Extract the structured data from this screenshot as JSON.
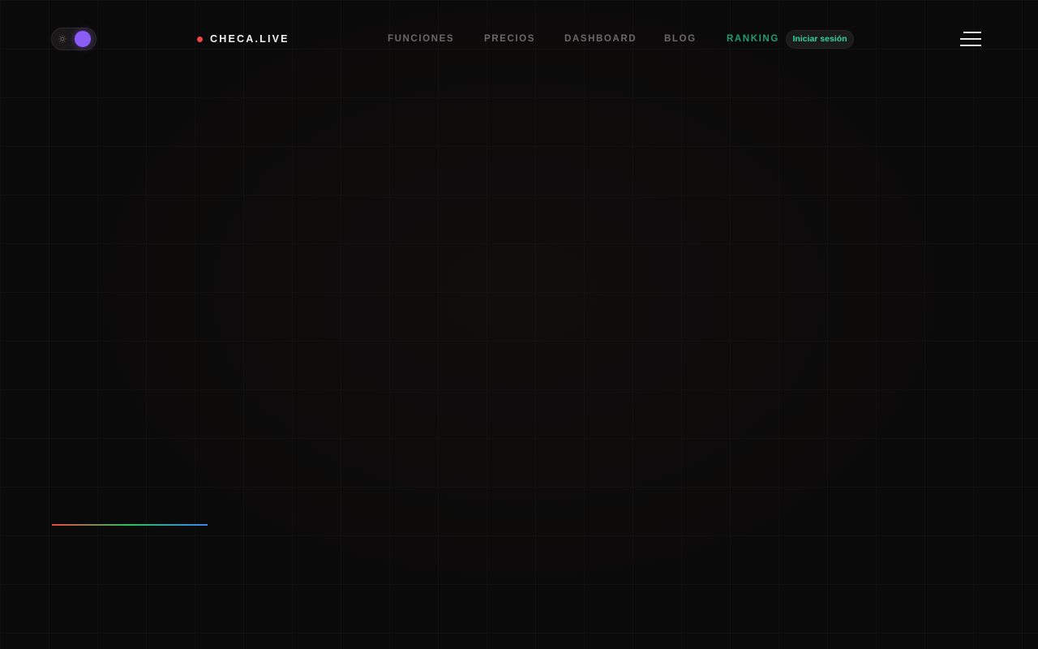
{
  "theme_toggle": {
    "state": "dark",
    "knob_color": "#8b5cf6",
    "icon": "sun-icon"
  },
  "brand": {
    "name": "CHECA.LIVE",
    "dot_color": "#ef4444"
  },
  "nav": {
    "items": [
      {
        "label": "FUNCIONES",
        "active": false
      },
      {
        "label": "PRECIOS",
        "active": false
      },
      {
        "label": "DASHBOARD",
        "active": false
      },
      {
        "label": "BLOG",
        "active": false
      },
      {
        "label": "RANKING",
        "active": true
      }
    ],
    "active_color": "#1f9e6d",
    "login_label": "Iniciar sesión",
    "login_color": "#34d399"
  },
  "menu": {
    "icon": "hamburger-icon"
  },
  "accent_line": {
    "progress": 1.0,
    "colors": [
      "#ef4444",
      "#22c55e",
      "#3b82f6"
    ]
  }
}
